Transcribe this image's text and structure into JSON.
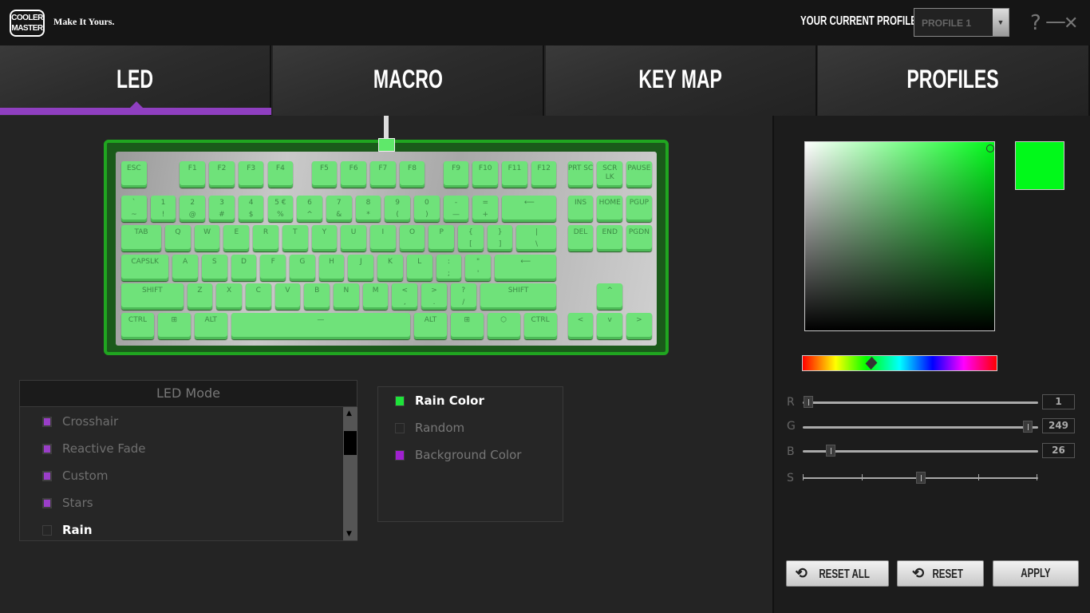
{
  "header": {
    "logo": "COOLER MASTER",
    "tagline": "Make It Yours.",
    "profile_label": "YOUR CURRENT PROFILE",
    "profile_value": "PROFILE 1",
    "help": "?",
    "minimize": "—",
    "close": "✕"
  },
  "tabs": [
    {
      "label": "LED",
      "active": true
    },
    {
      "label": "MACRO"
    },
    {
      "label": "KEY MAP"
    },
    {
      "label": "PROFILES"
    }
  ],
  "colors": {
    "accent": "#8f3fc0",
    "key_led": "#6fe27a",
    "frame": "#20a520",
    "selected": "#00f91a"
  },
  "keyboard": {
    "rows": [
      [
        "ESC",
        "F1",
        "F2",
        "F3",
        "F4",
        "F5",
        "F6",
        "F7",
        "F8",
        "F9",
        "F10",
        "F11",
        "F12",
        "PRT SC",
        "SCR LK",
        "PAUSE"
      ],
      [
        [
          "`",
          "~"
        ],
        [
          "1",
          "!"
        ],
        [
          "2",
          "@"
        ],
        [
          "3",
          "#"
        ],
        [
          "4",
          "$"
        ],
        [
          "5 €",
          "%"
        ],
        [
          "6",
          "^"
        ],
        [
          "7",
          "&"
        ],
        [
          "8",
          "*"
        ],
        [
          "9",
          "("
        ],
        [
          "0",
          ")"
        ],
        [
          "-",
          "—"
        ],
        [
          "=",
          "+"
        ],
        "⟵",
        "INS",
        "HOME",
        "PGUP"
      ],
      [
        "TAB",
        "Q",
        "W",
        "E",
        "R",
        "T",
        "Y",
        "U",
        "I",
        "O",
        "P",
        [
          "{",
          "["
        ],
        [
          "}",
          "]"
        ],
        [
          "|",
          "\\"
        ],
        "DEL",
        "END",
        "PGDN"
      ],
      [
        "CAPSLK",
        "A",
        "S",
        "D",
        "F",
        "G",
        "H",
        "J",
        "K",
        "L",
        [
          ":",
          ";"
        ],
        [
          "\"",
          "'"
        ],
        "⟵"
      ],
      [
        "SHIFT",
        "Z",
        "X",
        "C",
        "V",
        "B",
        "N",
        "M",
        [
          "<",
          ","
        ],
        [
          ">",
          "."
        ],
        [
          "?",
          "/"
        ],
        "SHIFT",
        "^"
      ],
      [
        "CTRL",
        "⊞",
        "ALT",
        "—",
        "ALT",
        "⊞",
        "⬡",
        "CTRL",
        "<",
        "v",
        ">"
      ]
    ]
  },
  "led_mode": {
    "title": "LED Mode",
    "items": [
      {
        "label": "Crosshair",
        "checked": true
      },
      {
        "label": "Reactive Fade",
        "checked": true
      },
      {
        "label": "Custom",
        "checked": true
      },
      {
        "label": "Stars",
        "checked": true
      },
      {
        "label": "Rain",
        "checked": false,
        "selected": true
      }
    ]
  },
  "options": [
    {
      "label": "Rain Color",
      "color": "#1ee33a",
      "selected": true
    },
    {
      "label": "Random",
      "color": ""
    },
    {
      "label": "Background Color",
      "color": "#a020d0"
    }
  ],
  "color": {
    "r": "1",
    "g": "249",
    "b": "26",
    "s_level": 0.5,
    "r_label": "R",
    "g_label": "G",
    "b_label": "B",
    "s_label": "S"
  },
  "buttons": {
    "reset_all": "RESET ALL",
    "reset": "RESET",
    "apply": "APPLY"
  }
}
